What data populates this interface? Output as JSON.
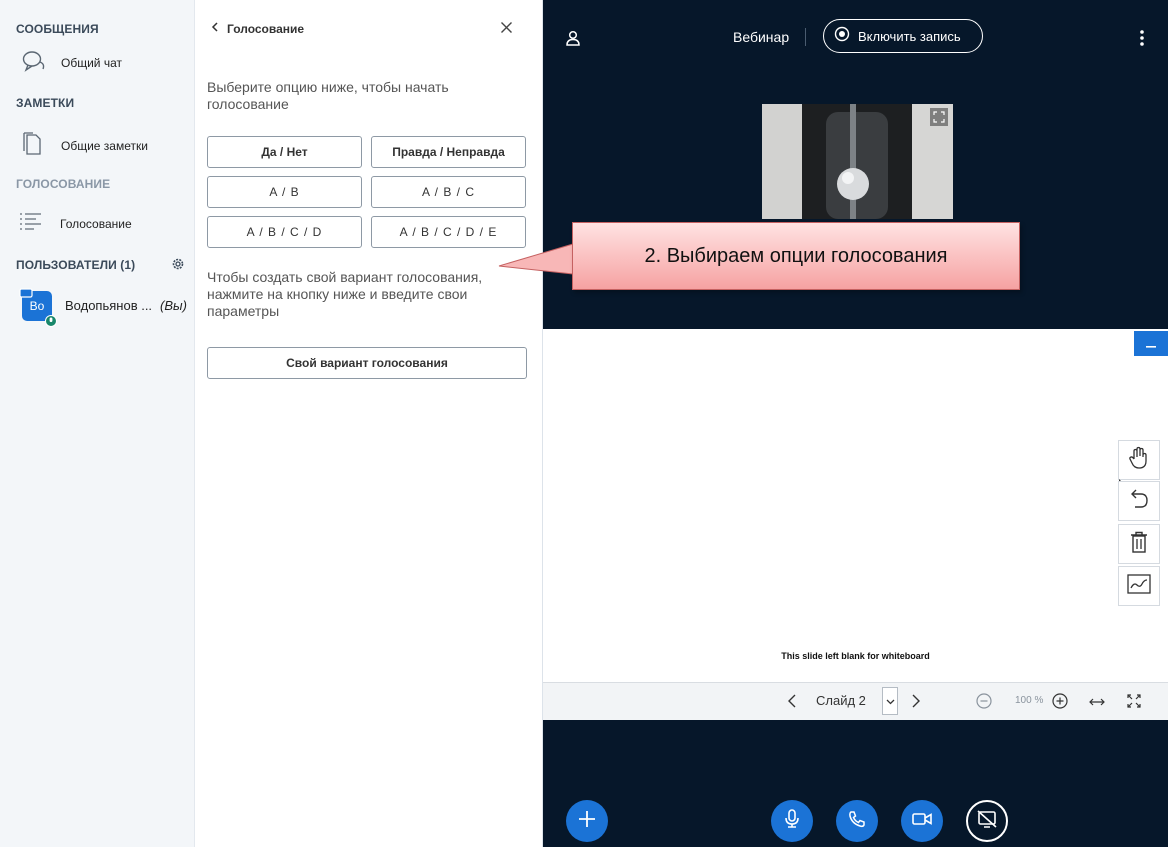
{
  "sidebar": {
    "messages_title": "СООБЩЕНИЯ",
    "public_chat": "Общий чат",
    "notes_title": "ЗАМЕТКИ",
    "shared_notes": "Общие заметки",
    "polling_title": "ГОЛОСОВАНИЕ",
    "polling_item": "Голосование",
    "users_title": "ПОЛЬЗОВАТЕЛИ (1)",
    "user": {
      "initials": "Во",
      "name": "Водопьянов ...",
      "you_label": "(Вы)"
    }
  },
  "poll": {
    "header": "Голосование",
    "intro": "Выберите опцию ниже, чтобы начать голосование",
    "options": [
      "Да / Нет",
      "Правда / Неправда",
      "A / B",
      "A / B / C",
      "A / B / C / D",
      "A / B / C / D / E"
    ],
    "custom_hint": "Чтобы создать свой вариант голосования, нажмите на кнопку ниже и введите свои параметры",
    "custom_button": "Свой вариант голосования"
  },
  "navbar": {
    "title": "Вебинар",
    "record_button": "Включить запись"
  },
  "whiteboard": {
    "blank_text": "This slide left blank for whiteboard",
    "slide_label": "Слайд 2",
    "zoom": "100 %"
  },
  "callout": {
    "text": "2. Выбираем опции голосования"
  },
  "colors": {
    "accent": "#1b73d6",
    "main_bg": "#06172a",
    "callout_fill": "#f6a2a2"
  }
}
